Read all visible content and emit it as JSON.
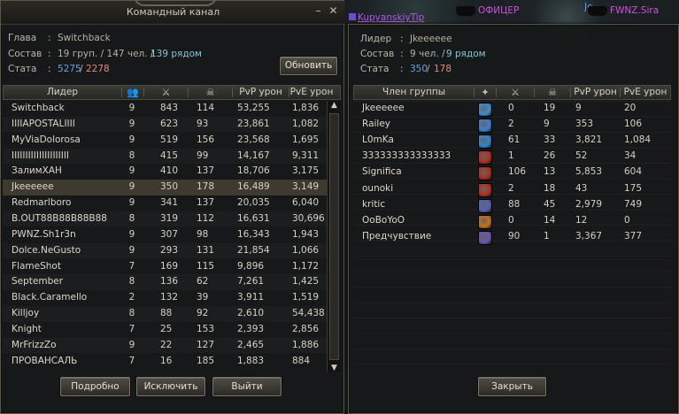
{
  "world": {
    "nameplates": [
      {
        "text": "KupyanskiyTip",
        "color": "#b058e6"
      },
      {
        "text": "ОФИЦЕР",
        "color": "#d04fd9"
      },
      {
        "text": "Je",
        "color": "#6b8dff"
      },
      {
        "text": "FWNZ.Sira",
        "color": "#d04fd9"
      }
    ]
  },
  "left_window": {
    "title": "Командный канал",
    "info": {
      "leader_label": "Глава",
      "leader_value": "Switchback",
      "composition_label": "Состав",
      "composition_groups": "19 груп. / 147 чел. /",
      "composition_nearby": "139 рядом",
      "stats_label": "Стата",
      "stats_a": "5275",
      "stats_sep": "/",
      "stats_b": "2278"
    },
    "refresh_button": "Обновить",
    "columns": [
      "Лидер",
      "",
      "",
      "",
      "PvP урон",
      "PvE урон"
    ],
    "column_icons": [
      "party-members-icon",
      "kills-icon",
      "deaths-icon"
    ],
    "rows": [
      [
        "Switchback",
        "9",
        "843",
        "114",
        "53,255",
        "1,836"
      ],
      [
        "IIIIAPOSTALIIII",
        "9",
        "623",
        "93",
        "23,861",
        "1,082"
      ],
      [
        "MyViaDolorosa",
        "9",
        "519",
        "156",
        "23,568",
        "1,695"
      ],
      [
        "IIIIIIIIIIIIIIIIIIIII",
        "8",
        "415",
        "99",
        "14,167",
        "9,311"
      ],
      [
        "ЗалимХАН",
        "9",
        "410",
        "137",
        "18,706",
        "3,175"
      ],
      [
        "Jkeeeeee",
        "9",
        "350",
        "178",
        "16,489",
        "3,149"
      ],
      [
        "Redmarlboro",
        "9",
        "341",
        "137",
        "20,035",
        "6,040"
      ],
      [
        "B.OUT88B88B88B88",
        "8",
        "319",
        "112",
        "16,631",
        "30,696"
      ],
      [
        "PWNZ.Sh1r3n",
        "9",
        "307",
        "98",
        "16,343",
        "1,943"
      ],
      [
        "Dolce.NeGusto",
        "9",
        "293",
        "131",
        "21,854",
        "1,066"
      ],
      [
        "FlameShot",
        "7",
        "169",
        "115",
        "9,896",
        "1,172"
      ],
      [
        "September",
        "8",
        "136",
        "62",
        "7,261",
        "1,425"
      ],
      [
        "Black.Caramello",
        "2",
        "132",
        "39",
        "3,911",
        "1,519"
      ],
      [
        "Killjoy",
        "8",
        "88",
        "92",
        "2,610",
        "54,438"
      ],
      [
        "Knight",
        "7",
        "25",
        "153",
        "2,393",
        "2,856"
      ],
      [
        "MrFrizzZo",
        "9",
        "22",
        "127",
        "2,465",
        "1,886"
      ],
      [
        "ПРОВАНСАЛЬ",
        "7",
        "16",
        "185",
        "1,883",
        "884"
      ]
    ],
    "selected_row": 5,
    "buttons": {
      "details": "Подробно",
      "exclude": "Исключить",
      "exit": "Выйти"
    }
  },
  "right_window": {
    "info": {
      "leader_label": "Лидер",
      "leader_value": "Jkeeeeee",
      "composition_label": "Состав",
      "composition_count": "9 чел. /",
      "composition_nearby": "9 рядом",
      "stats_label": "Стата",
      "stats_a": "350",
      "stats_sep": "/",
      "stats_b": "178"
    },
    "columns": [
      "Член группы",
      "",
      "",
      "",
      "PvP урон",
      "PvE урон"
    ],
    "column_icons": [
      "class-icon",
      "kills-icon",
      "deaths-icon"
    ],
    "rows": [
      {
        "name": "Jkeeeeee",
        "cls": "#3a8fd0",
        "k": "0",
        "d": "19",
        "pvp": "9",
        "pve": "20"
      },
      {
        "name": "Railey",
        "cls": "#3c7fd6",
        "k": "2",
        "d": "9",
        "pvp": "353",
        "pve": "106"
      },
      {
        "name": "L0mKa",
        "cls": "#2f86d2",
        "k": "61",
        "d": "33",
        "pvp": "3,821",
        "pve": "1,084"
      },
      {
        "name": "333333333333333",
        "cls": "#b3301f",
        "k": "1",
        "d": "26",
        "pvp": "52",
        "pve": "34"
      },
      {
        "name": "Significa",
        "cls": "#b3301f",
        "k": "106",
        "d": "13",
        "pvp": "5,853",
        "pve": "604"
      },
      {
        "name": "ounoki",
        "cls": "#b3301f",
        "k": "2",
        "d": "18",
        "pvp": "43",
        "pve": "175"
      },
      {
        "name": "kritic",
        "cls": "#5560b8",
        "k": "88",
        "d": "45",
        "pvp": "2,979",
        "pve": "749"
      },
      {
        "name": "OoBoYoO",
        "cls": "#c87016",
        "k": "0",
        "d": "14",
        "pvp": "12",
        "pve": "0"
      },
      {
        "name": "Предчувствие",
        "cls": "#6a55b0",
        "k": "90",
        "d": "1",
        "pvp": "3,367",
        "pve": "377"
      }
    ],
    "close_button": "Закрыть"
  },
  "icons": {
    "close": "close-icon",
    "minimize": "minimize-icon",
    "scroll_up": "scroll-up-icon",
    "scroll_down": "scroll-down-icon"
  }
}
